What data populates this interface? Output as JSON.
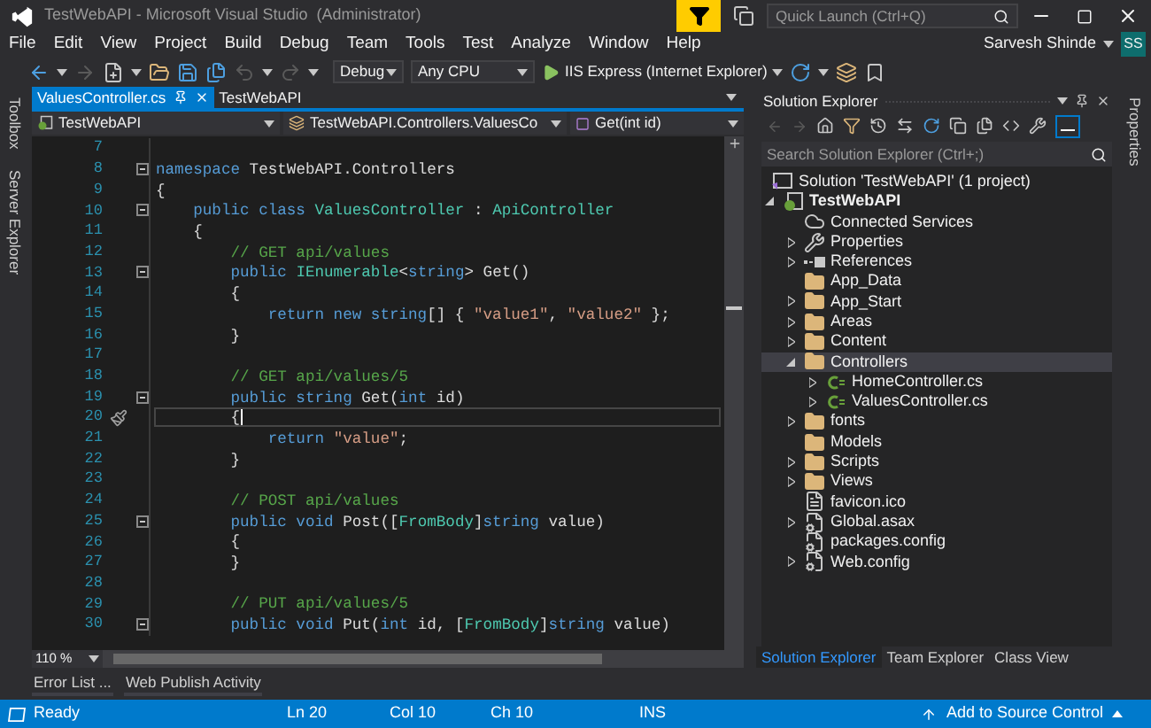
{
  "window": {
    "title": "TestWebAPI - Microsoft Visual Studio  (Administrator)",
    "quick_launch": {
      "placeholder": "Quick Launch (Ctrl+Q)"
    }
  },
  "menu": [
    "File",
    "Edit",
    "View",
    "Project",
    "Build",
    "Debug",
    "Team",
    "Tools",
    "Test",
    "Analyze",
    "Window",
    "Help"
  ],
  "account": {
    "name": "Sarvesh Shinde",
    "initials": "SS"
  },
  "toolbar": {
    "configuration": "Debug",
    "platform": "Any CPU",
    "run_target": "IIS Express (Internet Explorer)"
  },
  "side_tabs_left": [
    "Toolbox",
    "Server Explorer"
  ],
  "side_tabs_right": [
    "Properties"
  ],
  "editor": {
    "tabs": [
      {
        "label": "ValuesController.cs",
        "selected": true
      },
      {
        "label": "TestWebAPI",
        "selected": false
      }
    ],
    "navigation": [
      "TestWebAPI",
      "TestWebAPI.Controllers.ValuesCo",
      "Get(int id)"
    ],
    "lines": [
      {
        "number": "7",
        "foldable": false,
        "current": false
      },
      {
        "number": "8",
        "foldable": true,
        "current": false,
        "tokens": [
          {
            "kind": "keyword",
            "text": "namespace"
          },
          {
            "kind": "plain",
            "text": " TestWebAPI.Controllers"
          }
        ]
      },
      {
        "number": "9",
        "foldable": false,
        "current": false,
        "tokens": [
          {
            "kind": "plain",
            "text": "{"
          }
        ]
      },
      {
        "number": "10",
        "foldable": true,
        "current": false,
        "tokens": [
          {
            "kind": "keyword",
            "text": "    public class "
          },
          {
            "kind": "type",
            "text": "ValuesController"
          },
          {
            "kind": "plain",
            "text": " : "
          },
          {
            "kind": "type",
            "text": "ApiController"
          }
        ]
      },
      {
        "number": "11",
        "foldable": false,
        "current": false,
        "tokens": [
          {
            "kind": "plain",
            "text": "    {"
          }
        ]
      },
      {
        "number": "12",
        "foldable": false,
        "current": false,
        "tokens": [
          {
            "kind": "comment",
            "text": "        // GET api/values"
          }
        ]
      },
      {
        "number": "13",
        "foldable": true,
        "current": false,
        "tokens": [
          {
            "kind": "keyword",
            "text": "        public "
          },
          {
            "kind": "type",
            "text": "IEnumerable"
          },
          {
            "kind": "plain",
            "text": "<"
          },
          {
            "kind": "keyword",
            "text": "string"
          },
          {
            "kind": "plain",
            "text": "> Get()"
          }
        ]
      },
      {
        "number": "14",
        "foldable": false,
        "current": false,
        "tokens": [
          {
            "kind": "plain",
            "text": "        {"
          }
        ]
      },
      {
        "number": "15",
        "foldable": false,
        "current": false,
        "tokens": [
          {
            "kind": "keyword",
            "text": "            return new string"
          },
          {
            "kind": "plain",
            "text": "[] { "
          },
          {
            "kind": "string",
            "text": "\"value1\""
          },
          {
            "kind": "plain",
            "text": ", "
          },
          {
            "kind": "string",
            "text": "\"value2\""
          },
          {
            "kind": "plain",
            "text": " };"
          }
        ]
      },
      {
        "number": "16",
        "foldable": false,
        "current": false,
        "tokens": [
          {
            "kind": "plain",
            "text": "        }"
          }
        ]
      },
      {
        "number": "17",
        "foldable": false,
        "current": false
      },
      {
        "number": "18",
        "foldable": false,
        "current": false,
        "tokens": [
          {
            "kind": "comment",
            "text": "        // GET api/values/5"
          }
        ]
      },
      {
        "number": "19",
        "foldable": true,
        "current": false,
        "tokens": [
          {
            "kind": "keyword",
            "text": "        public string"
          },
          {
            "kind": "plain",
            "text": " Get("
          },
          {
            "kind": "keyword",
            "text": "int"
          },
          {
            "kind": "plain",
            "text": " id)"
          }
        ]
      },
      {
        "number": "20",
        "foldable": false,
        "current": true,
        "tokens": [
          {
            "kind": "plain",
            "text": "        {"
          }
        ]
      },
      {
        "number": "21",
        "foldable": false,
        "current": false,
        "tokens": [
          {
            "kind": "keyword",
            "text": "            return "
          },
          {
            "kind": "string",
            "text": "\"value\""
          },
          {
            "kind": "plain",
            "text": ";"
          }
        ]
      },
      {
        "number": "22",
        "foldable": false,
        "current": false,
        "tokens": [
          {
            "kind": "plain",
            "text": "        }"
          }
        ]
      },
      {
        "number": "23",
        "foldable": false,
        "current": false
      },
      {
        "number": "24",
        "foldable": false,
        "current": false,
        "tokens": [
          {
            "kind": "comment",
            "text": "        // POST api/values"
          }
        ]
      },
      {
        "number": "25",
        "foldable": true,
        "current": false,
        "tokens": [
          {
            "kind": "keyword",
            "text": "        public void"
          },
          {
            "kind": "plain",
            "text": " Post(["
          },
          {
            "kind": "type",
            "text": "FromBody"
          },
          {
            "kind": "plain",
            "text": "]"
          },
          {
            "kind": "keyword",
            "text": "string"
          },
          {
            "kind": "plain",
            "text": " value)"
          }
        ]
      },
      {
        "number": "26",
        "foldable": false,
        "current": false,
        "tokens": [
          {
            "kind": "plain",
            "text": "        {"
          }
        ]
      },
      {
        "number": "27",
        "foldable": false,
        "current": false,
        "tokens": [
          {
            "kind": "plain",
            "text": "        }"
          }
        ]
      },
      {
        "number": "28",
        "foldable": false,
        "current": false
      },
      {
        "number": "29",
        "foldable": false,
        "current": false,
        "tokens": [
          {
            "kind": "comment",
            "text": "        // PUT api/values/5"
          }
        ]
      },
      {
        "number": "30",
        "foldable": true,
        "current": false,
        "tokens": [
          {
            "kind": "keyword",
            "text": "        public void"
          },
          {
            "kind": "plain",
            "text": " Put("
          },
          {
            "kind": "keyword",
            "text": "int"
          },
          {
            "kind": "plain",
            "text": " id, ["
          },
          {
            "kind": "type",
            "text": "FromBody"
          },
          {
            "kind": "plain",
            "text": "]"
          },
          {
            "kind": "keyword",
            "text": "string"
          },
          {
            "kind": "plain",
            "text": " value)"
          }
        ]
      }
    ],
    "zoom": "110 %"
  },
  "tool_tabs": [
    "Error List ...",
    "Web Publish Activity"
  ],
  "solution_explorer": {
    "title": "Solution Explorer",
    "search": {
      "placeholder": "Search Solution Explorer (Ctrl+;)"
    },
    "tree": [
      {
        "label": "Solution 'TestWebAPI' (1 project)",
        "kind": "solution",
        "selected": false,
        "children": [
          {
            "label": "TestWebAPI",
            "kind": "project",
            "bold": true,
            "expanded": true,
            "selected": false,
            "children": [
              {
                "label": "Connected Services",
                "kind": "cloud",
                "selected": false
              },
              {
                "label": "Properties",
                "kind": "wrench",
                "expanded": false,
                "selected": false
              },
              {
                "label": "References",
                "kind": "references",
                "expanded": false,
                "selected": false
              },
              {
                "label": "App_Data",
                "kind": "folder",
                "selected": false
              },
              {
                "label": "App_Start",
                "kind": "folder",
                "expanded": false,
                "selected": false
              },
              {
                "label": "Areas",
                "kind": "folder",
                "expanded": false,
                "selected": false
              },
              {
                "label": "Content",
                "kind": "folder",
                "expanded": false,
                "selected": false
              },
              {
                "label": "Controllers",
                "kind": "folder",
                "expanded": true,
                "selected": true,
                "children": [
                  {
                    "label": "HomeController.cs",
                    "kind": "csharp",
                    "expanded": false,
                    "selected": false
                  },
                  {
                    "label": "ValuesController.cs",
                    "kind": "csharp",
                    "expanded": false,
                    "selected": false
                  }
                ]
              },
              {
                "label": "fonts",
                "kind": "folder",
                "expanded": false,
                "selected": false
              },
              {
                "label": "Models",
                "kind": "folder",
                "selected": false
              },
              {
                "label": "Scripts",
                "kind": "folder",
                "expanded": false,
                "selected": false
              },
              {
                "label": "Views",
                "kind": "folder",
                "expanded": false,
                "selected": false
              },
              {
                "label": "favicon.ico",
                "kind": "file",
                "selected": false
              },
              {
                "label": "Global.asax",
                "kind": "config",
                "expanded": false,
                "selected": false
              },
              {
                "label": "packages.config",
                "kind": "config",
                "selected": false
              },
              {
                "label": "Web.config",
                "kind": "config",
                "expanded": false,
                "selected": false
              }
            ]
          }
        ]
      }
    ],
    "tabs": [
      {
        "label": "Solution Explorer",
        "selected": true
      },
      {
        "label": "Team Explorer",
        "selected": false
      },
      {
        "label": "Class View",
        "selected": false
      }
    ]
  },
  "status_bar": {
    "state": "Ready",
    "line": "Ln 20",
    "column": "Col 10",
    "char": "Ch 10",
    "mode": "INS",
    "source_control": "Add to Source Control"
  }
}
